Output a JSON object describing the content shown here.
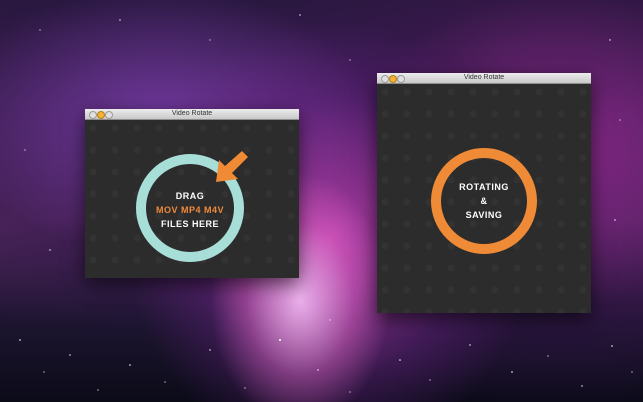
{
  "window_left": {
    "title": "Video Rotate",
    "drag_line1": "DRAG",
    "drag_line2": "MOV MP4 M4V",
    "drag_line3": "FILES HERE"
  },
  "window_right": {
    "title": "Video Rotate",
    "status_line1": "ROTATING",
    "status_line2": "&",
    "status_line3": "SAVING"
  },
  "colors": {
    "ring_drop": "#a8ded8",
    "arrow": "#f08a35",
    "ring_status": "#ef8a36",
    "file_types_text": "#f18a3a"
  },
  "icons": {
    "drop_arrow": "arrow-down-left-icon"
  }
}
